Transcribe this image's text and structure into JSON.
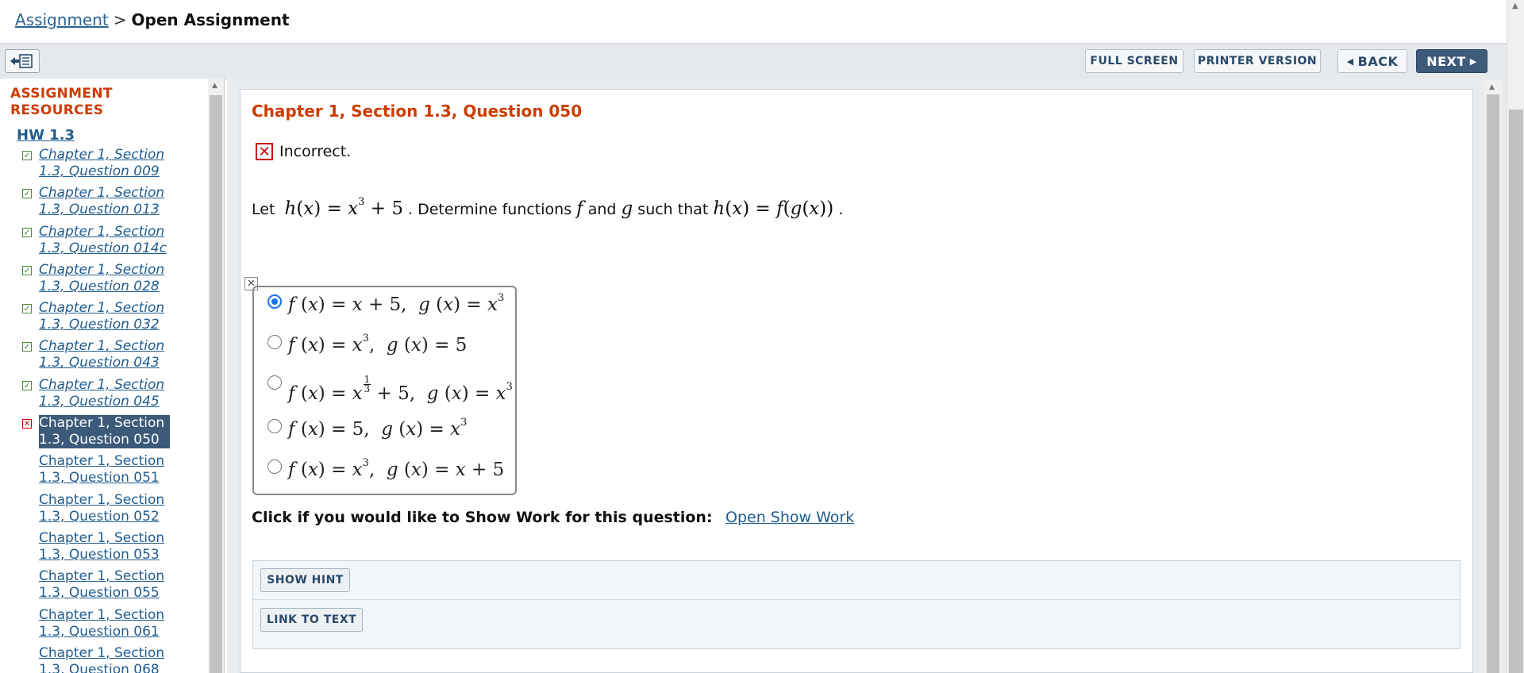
{
  "breadcrumb": {
    "parent": "Assignment",
    "separator": ">",
    "current": "Open Assignment"
  },
  "toolbar": {
    "full_screen": "FULL SCREEN",
    "printer_version": "PRINTER VERSION",
    "back": "BACK",
    "next": "NEXT"
  },
  "sidebar": {
    "title_line1": "ASSIGNMENT",
    "title_line2": "RESOURCES",
    "hw": "HW 1.3",
    "items": [
      {
        "line1": "Chapter 1, Section",
        "line2": "1.3, Question 009"
      },
      {
        "line1": "Chapter 1, Section",
        "line2": "1.3, Question 013"
      },
      {
        "line1": "Chapter 1, Section",
        "line2": "1.3, Question 014c"
      },
      {
        "line1": "Chapter 1, Section",
        "line2": "1.3, Question 028"
      },
      {
        "line1": "Chapter 1, Section",
        "line2": "1.3, Question 032"
      },
      {
        "line1": "Chapter 1, Section",
        "line2": "1.3, Question 043"
      },
      {
        "line1": "Chapter 1, Section",
        "line2": "1.3, Question 045"
      },
      {
        "line1": "Chapter 1, Section",
        "line2": "1.3, Question 050"
      },
      {
        "line1": "Chapter 1, Section",
        "line2": "1.3, Question 051"
      },
      {
        "line1": "Chapter 1, Section",
        "line2": "1.3, Question 052"
      },
      {
        "line1": "Chapter 1, Section",
        "line2": "1.3, Question 053"
      },
      {
        "line1": "Chapter 1, Section",
        "line2": "1.3, Question 055"
      },
      {
        "line1": "Chapter 1, Section",
        "line2": "1.3, Question 061"
      },
      {
        "line1": "Chapter 1, Section",
        "line2": "1.3, Question 068"
      }
    ]
  },
  "question": {
    "title": "Chapter 1, Section 1.3, Question 050",
    "status": "Incorrect.",
    "stem": {
      "let": "Let",
      "determine": ". Determine functions",
      "and": "and",
      "such_that": "such that",
      "end": "."
    }
  },
  "choices": {
    "selected_index": 0,
    "count": 5
  },
  "show_work": {
    "prompt": "Click if you would like to Show Work for this question:",
    "link": "Open Show Work"
  },
  "actions": {
    "hint": "SHOW HINT",
    "link_to_text": "LINK TO TEXT"
  },
  "colors": {
    "accent_orange": "#cc3c00",
    "link_blue": "#1f5c8f",
    "next_button": "#3d5a7a",
    "incorrect_red": "#cc0000",
    "check_green": "#2f7d22"
  },
  "icons": {
    "menu_toggle": "collapse-menu-icon",
    "correct": "check-icon",
    "incorrect": "x-icon",
    "back": "caret-left-icon",
    "next": "caret-right-icon"
  }
}
